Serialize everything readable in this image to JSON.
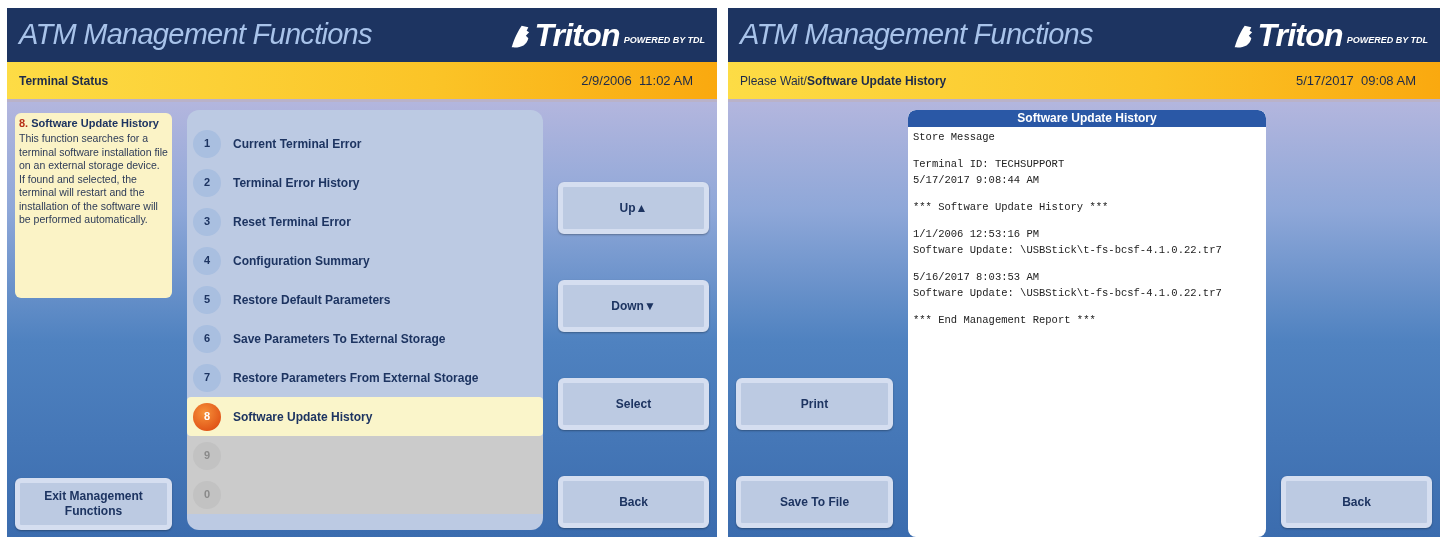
{
  "screens": [
    {
      "kind": "menu",
      "title": "ATM Management Functions",
      "logo": {
        "brand": "Triton",
        "tagline": "POWERED BY TDL"
      },
      "status": "**Terminal Status**",
      "datetime": "2/9/2006  11:02 AM",
      "info_panel": {
        "number": "8.",
        "title": "Software Update History",
        "description": "This function searches for a terminal software installation file on an external storage device. If found and selected, the terminal will restart and the installation of the software will be performed automatically."
      },
      "menu_items": [
        {
          "number": "1",
          "label": "Current Terminal Error",
          "selected": false,
          "disabled": false
        },
        {
          "number": "2",
          "label": "Terminal Error History",
          "selected": false,
          "disabled": false
        },
        {
          "number": "3",
          "label": "Reset Terminal Error",
          "selected": false,
          "disabled": false
        },
        {
          "number": "4",
          "label": "Configuration Summary",
          "selected": false,
          "disabled": false
        },
        {
          "number": "5",
          "label": "Restore Default Parameters",
          "selected": false,
          "disabled": false
        },
        {
          "number": "6",
          "label": "Save Parameters To External Storage",
          "selected": false,
          "disabled": false
        },
        {
          "number": "7",
          "label": "Restore Parameters From External Storage",
          "selected": false,
          "disabled": false
        },
        {
          "number": "8",
          "label": "Software Update History",
          "selected": true,
          "disabled": false
        },
        {
          "number": "9",
          "selected": false,
          "disabled": true
        },
        {
          "number": "0",
          "selected": false,
          "disabled": true
        }
      ],
      "left_buttons": [
        {
          "label": "Exit Management Functions"
        }
      ],
      "right_buttons": [
        {
          "label": "Up▲"
        },
        {
          "label": "Down▼"
        },
        {
          "label": "Select"
        },
        {
          "label": "Back"
        }
      ]
    },
    {
      "kind": "report",
      "title": "ATM Management Functions",
      "logo": {
        "brand": "Triton",
        "tagline": "POWERED BY TDL"
      },
      "status": "Please Wait/**Software Update History**",
      "datetime": "5/17/2017  09:08 AM",
      "report": {
        "title": "Software Update History",
        "blocks": [
          [
            "Store Message"
          ],
          [
            "Terminal ID: TECHSUPPORT",
            "5/17/2017 9:08:44 AM"
          ],
          [
            "*** Software Update History ***"
          ],
          [
            "1/1/2006 12:53:16 PM",
            "Software Update: \\USBStick\\t-fs-bcsf-4.1.0.22.tr7"
          ],
          [
            "5/16/2017 8:03:53 AM",
            "Software Update: \\USBStick\\t-fs-bcsf-4.1.0.22.tr7"
          ],
          [
            "*** End Management Report ***"
          ]
        ]
      },
      "left_buttons": [
        {
          "label": "Print"
        },
        {
          "label": "Save To File"
        }
      ],
      "right_buttons": [
        {
          "label": "Back"
        }
      ]
    }
  ]
}
